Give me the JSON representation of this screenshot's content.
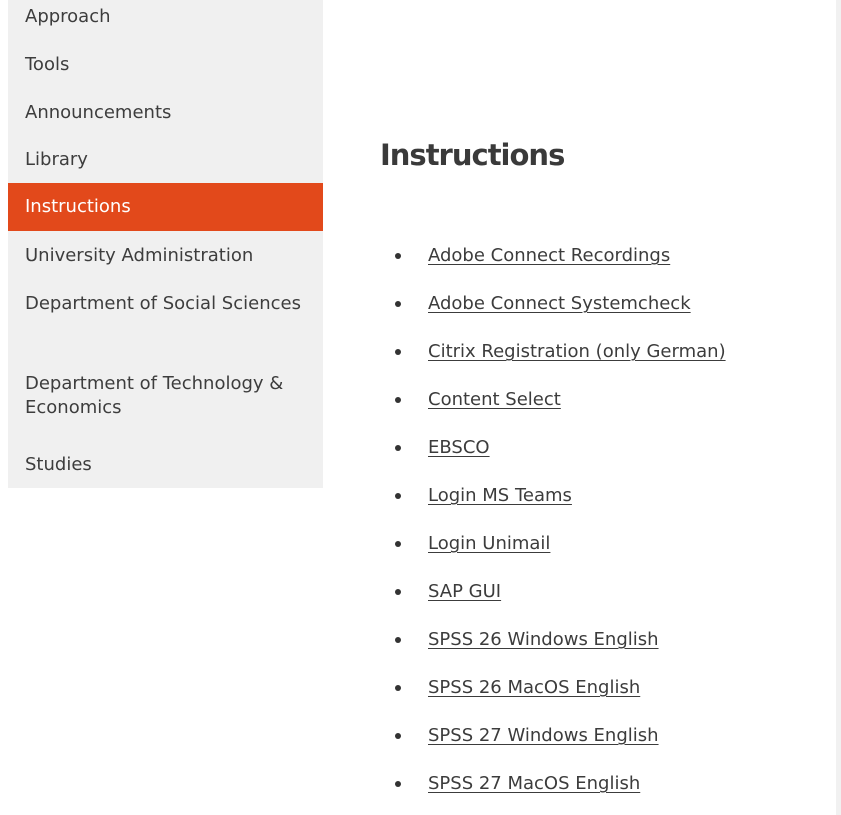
{
  "sidebar": {
    "items": [
      {
        "label": "Approach"
      },
      {
        "label": "Tools"
      },
      {
        "label": "Announcements"
      },
      {
        "label": "Library"
      },
      {
        "label": "Instructions",
        "active": true
      },
      {
        "label": "University Administration"
      },
      {
        "label": "Department of Social Sciences"
      },
      {
        "label": "Department of Technology & Economics"
      },
      {
        "label": "Studies"
      }
    ]
  },
  "main": {
    "title": "Instructions",
    "links": [
      {
        "label": "Adobe Connect Recordings"
      },
      {
        "label": "Adobe Connect Systemcheck"
      },
      {
        "label": "Citrix Registration (only German)"
      },
      {
        "label": "Content Select"
      },
      {
        "label": "EBSCO"
      },
      {
        "label": "Login MS Teams"
      },
      {
        "label": "Login Unimail"
      },
      {
        "label": "SAP GUI"
      },
      {
        "label": "SPSS 26 Windows English"
      },
      {
        "label": "SPSS 26 MacOS English"
      },
      {
        "label": "SPSS 27 Windows English"
      },
      {
        "label": "SPSS 27 MacOS English"
      }
    ]
  },
  "colors": {
    "accent": "#e2491b",
    "sidebar_bg": "#f0f0f0",
    "text": "#3c3c3c"
  }
}
